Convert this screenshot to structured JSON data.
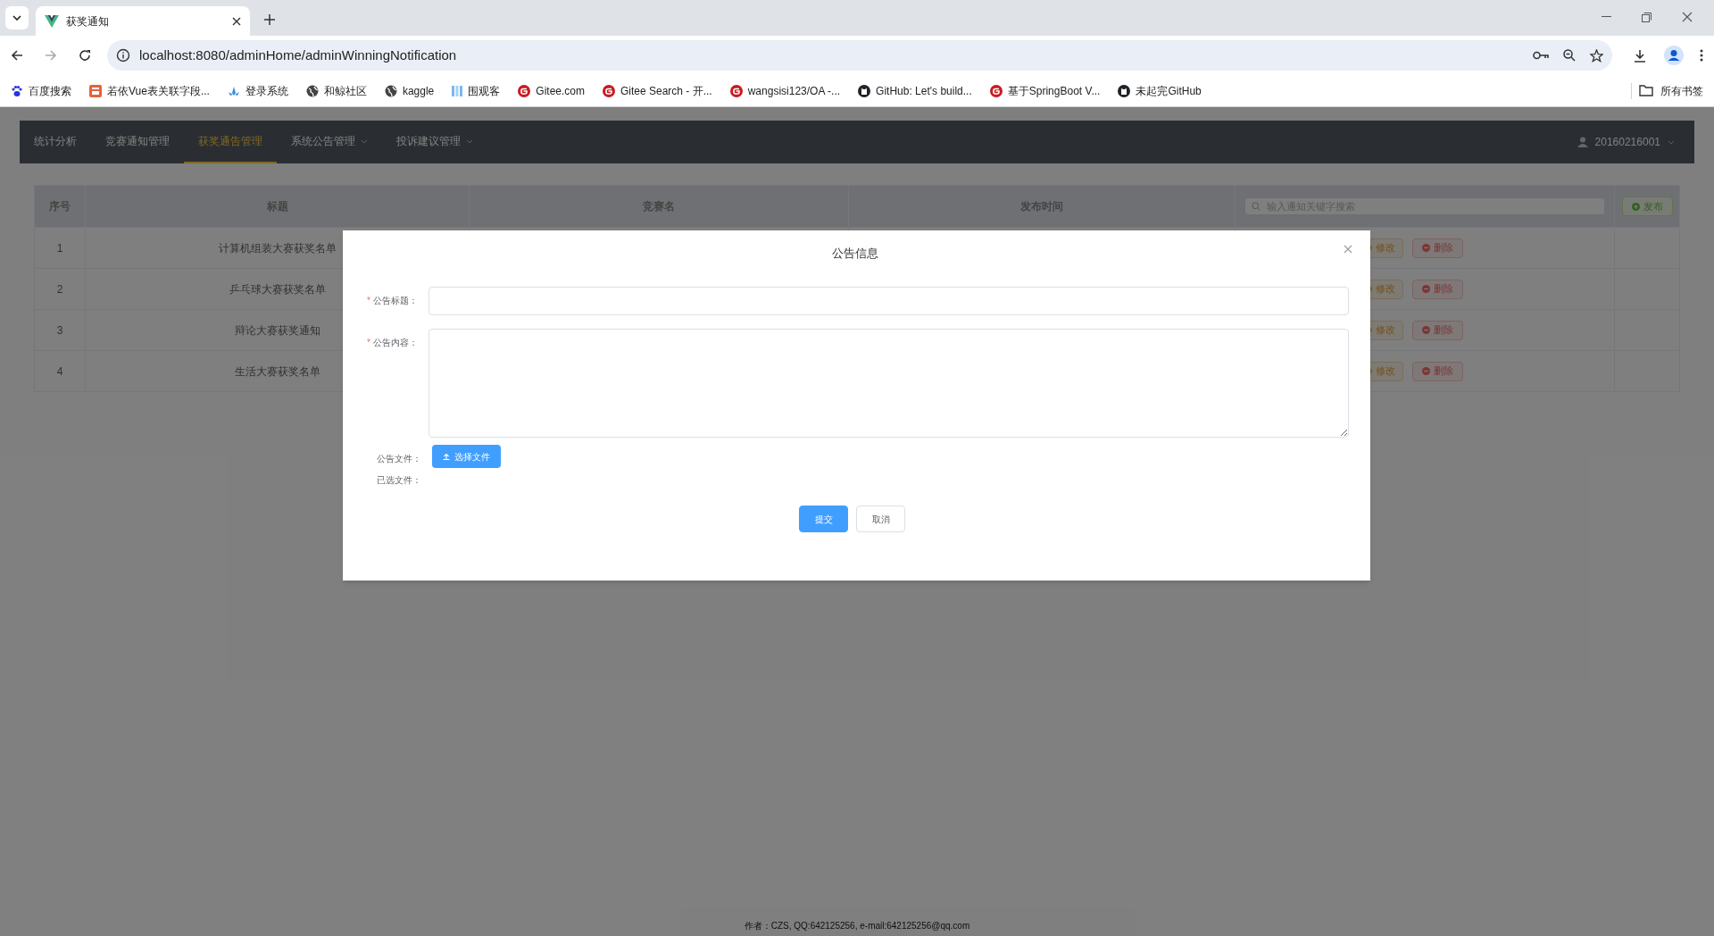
{
  "browser": {
    "tab_title": "获奖通知",
    "url": "localhost:8080/adminHome/adminWinningNotification",
    "bookmarks": [
      {
        "label": "百度搜索",
        "kind": "paw"
      },
      {
        "label": "若依Vue表关联字段...",
        "kind": "square"
      },
      {
        "label": "登录系统",
        "kind": "leaf"
      },
      {
        "label": "和鲸社区",
        "kind": "globe"
      },
      {
        "label": "kaggle",
        "kind": "globe"
      },
      {
        "label": "围观客",
        "kind": "bars"
      },
      {
        "label": "Gitee.com",
        "kind": "gcircle"
      },
      {
        "label": "Gitee Search - 开...",
        "kind": "gcircle"
      },
      {
        "label": "wangsisi123/OA -...",
        "kind": "gcircle"
      },
      {
        "label": "GitHub: Let's build...",
        "kind": "cat"
      },
      {
        "label": "基于SpringBoot V...",
        "kind": "gcircle"
      },
      {
        "label": "未起完GitHub",
        "kind": "cat"
      }
    ],
    "all_bookmarks": "所有书签"
  },
  "nav": {
    "items": [
      {
        "label": "统计分析",
        "selected": false,
        "dropdown": false
      },
      {
        "label": "竞赛通知管理",
        "selected": false,
        "dropdown": false
      },
      {
        "label": "获奖通告管理",
        "selected": true,
        "dropdown": false
      },
      {
        "label": "系统公告管理",
        "selected": false,
        "dropdown": true
      },
      {
        "label": "投诉建议管理",
        "selected": false,
        "dropdown": true
      }
    ],
    "user": "20160216001"
  },
  "table": {
    "columns": [
      "序号",
      "标题",
      "竞赛名",
      "发布时间"
    ],
    "search": {
      "placeholder": "输入通知关键字搜索"
    },
    "publish_button": "发布",
    "rows": [
      {
        "index": "1",
        "title": "计算机组装大赛获奖名单",
        "edit": "修改",
        "delete": "删除"
      },
      {
        "index": "2",
        "title": "乒乓球大赛获奖名单",
        "edit": "修改",
        "delete": "删除"
      },
      {
        "index": "3",
        "title": "辩论大赛获奖通知",
        "edit": "修改",
        "delete": "删除"
      },
      {
        "index": "4",
        "title": "生活大赛获奖名单",
        "edit": "修改",
        "delete": "删除"
      }
    ]
  },
  "dialog": {
    "title": "公告信息",
    "fields": [
      {
        "label": "公告标题：",
        "marker": "*",
        "kind": "input"
      },
      {
        "label": "公告内容：",
        "marker": "*",
        "kind": "textarea"
      },
      {
        "label": "公告文件：",
        "kind": "upload",
        "button": "选择文件"
      },
      {
        "label": "已选文件：",
        "kind": "text"
      }
    ],
    "buttons": [
      {
        "label": "提交",
        "kind": "primary"
      },
      {
        "label": "取消",
        "kind": "default"
      }
    ]
  },
  "footer": "作者：CZS, QQ:642125256, e-mail:642125256@qq.com"
}
